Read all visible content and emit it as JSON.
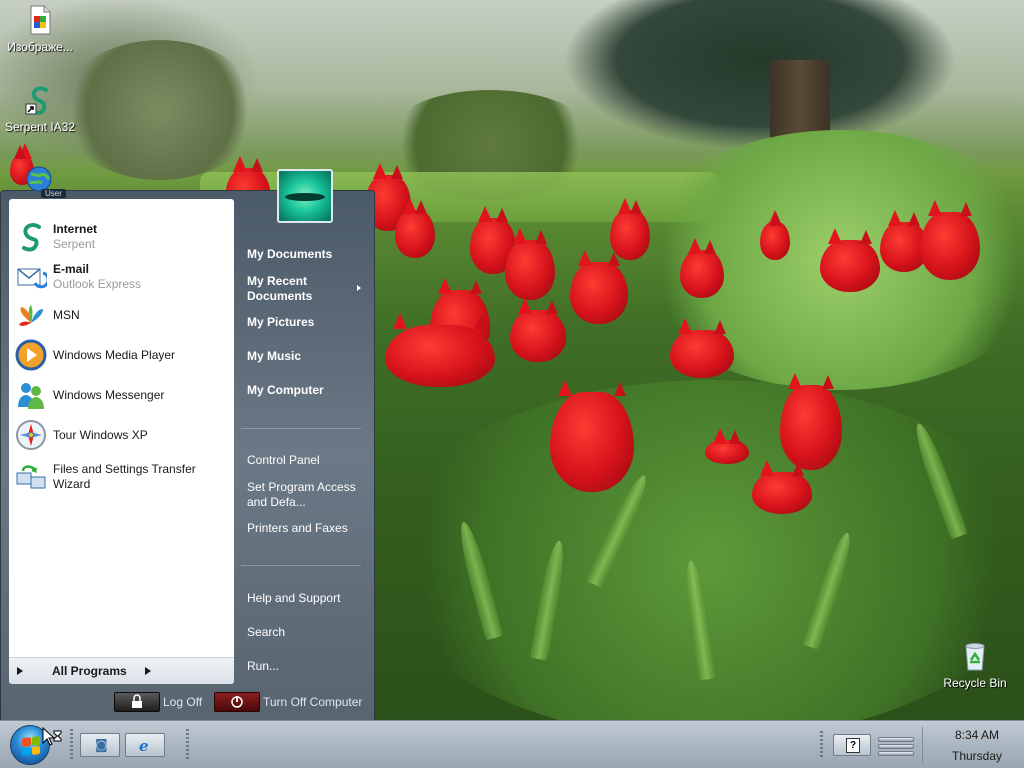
{
  "desktop": {
    "icons": [
      {
        "label": "Изображе...",
        "icon": "image-document-icon"
      },
      {
        "label": "Serpent IA32",
        "icon": "serpent-shortcut-icon"
      },
      {
        "label": "Recycle Bin",
        "icon": "recycle-bin-icon"
      }
    ]
  },
  "start_menu": {
    "user_badge": "User",
    "pinned": [
      {
        "name": "Internet",
        "sub": "Serpent",
        "icon": "serpent-browser-icon"
      },
      {
        "name": "E-mail",
        "sub": "Outlook Express",
        "icon": "outlook-express-icon"
      }
    ],
    "recent": [
      {
        "name": "MSN",
        "icon": "msn-butterfly-icon"
      },
      {
        "name": "Windows Media Player",
        "icon": "media-player-icon"
      },
      {
        "name": "Windows Messenger",
        "icon": "messenger-icon"
      },
      {
        "name": "Tour Windows XP",
        "icon": "tour-xp-icon"
      },
      {
        "name": "Files and Settings Transfer Wizard",
        "icon": "transfer-wizard-icon"
      }
    ],
    "all_programs": "All Programs",
    "right_pane": {
      "my_documents": "My Documents",
      "my_recent_documents": "My Recent Documents",
      "my_pictures": "My Pictures",
      "my_music": "My Music",
      "my_computer": "My Computer",
      "control_panel": "Control Panel",
      "set_program_access": "Set Program Access and Defa...",
      "printers_and_faxes": "Printers and Faxes",
      "help_and_support": "Help and Support",
      "search": "Search",
      "run": "Run..."
    },
    "log_off": "Log Off",
    "turn_off": "Turn Off Computer"
  },
  "taskbar": {
    "clock_time": "8:34 AM",
    "clock_day": "Thursday"
  }
}
